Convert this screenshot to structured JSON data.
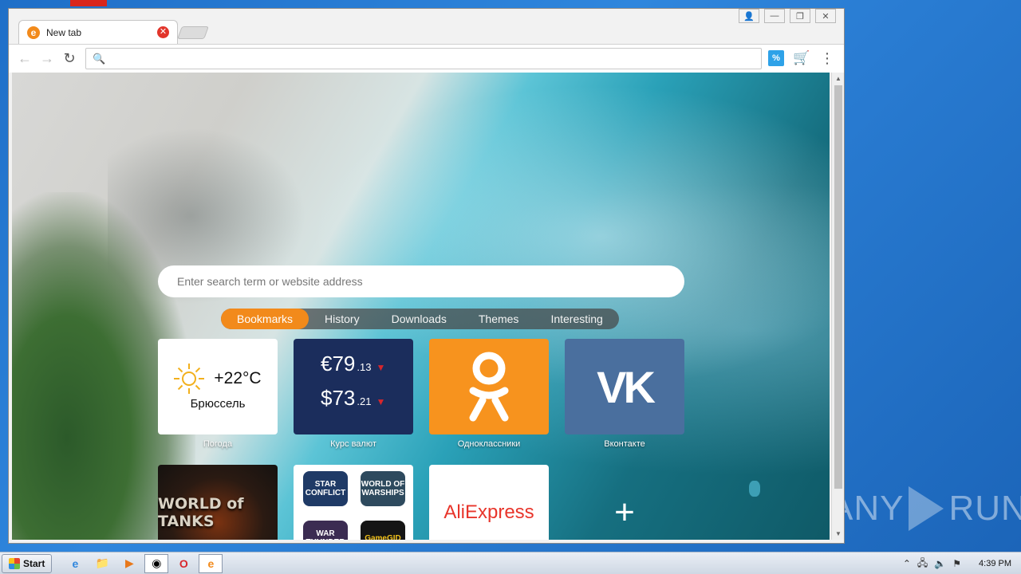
{
  "browser": {
    "tab_title": "New tab",
    "address_placeholder": "",
    "ext_percent_label": "%"
  },
  "newtab": {
    "search_placeholder": "Enter search term or website address",
    "nav": [
      "Bookmarks",
      "History",
      "Downloads",
      "Themes",
      "Interesting"
    ],
    "active_nav": "Bookmarks",
    "weather": {
      "temp": "+22°C",
      "city": "Брюссель",
      "caption": "Погода"
    },
    "currency": {
      "eur_main": "€79",
      "eur_frac": ".13",
      "usd_main": "$73",
      "usd_frac": ".21",
      "caption": "Курс валют"
    },
    "tiles": [
      {
        "caption": "Одноклассники"
      },
      {
        "caption": "Вконтакте",
        "logo": "vk"
      }
    ],
    "wot_logo": "WORLD of TANKS",
    "games": [
      "STAR CONFLICT",
      "WORLD OF WARSHIPS",
      "WAR THUNDER",
      "GameGID"
    ],
    "ali_logo": "AliExpress",
    "add_symbol": "+"
  },
  "taskbar": {
    "start_label": "Start",
    "clock": "4:39 PM"
  },
  "watermark": "ANY RUN",
  "colors": {
    "accent_orange": "#f28a1b",
    "ok_orange": "#f7931e",
    "vk_blue": "#4a6f9e",
    "currency_navy": "#1b2d5c",
    "down_red": "#d8262c"
  }
}
